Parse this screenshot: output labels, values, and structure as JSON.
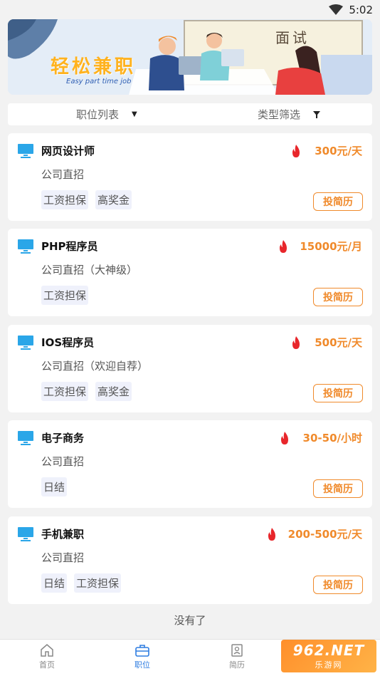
{
  "status": {
    "time": "5:02"
  },
  "banner": {
    "title": "轻松兼职",
    "subtitle": "Easy part time job",
    "board_text": "面试"
  },
  "filter": {
    "list_label": "职位列表",
    "type_label": "类型筛选"
  },
  "jobs": [
    {
      "title": "网页设计师",
      "salary": "300元/天",
      "company": "公司直招",
      "tags": [
        "工资担保",
        "高奖金"
      ],
      "apply": "投简历"
    },
    {
      "title": "PHP程序员",
      "salary": "15000元/月",
      "company": "公司直招（大神级）",
      "tags": [
        "工资担保"
      ],
      "apply": "投简历"
    },
    {
      "title": "IOS程序员",
      "salary": "500元/天",
      "company": "公司直招（欢迎自荐）",
      "tags": [
        "工资担保",
        "高奖金"
      ],
      "apply": "投简历"
    },
    {
      "title": "电子商务",
      "salary": "30-50/小时",
      "company": "公司直招",
      "tags": [
        "日结"
      ],
      "apply": "投简历"
    },
    {
      "title": "手机兼职",
      "salary": "200-500元/天",
      "company": "公司直招",
      "tags": [
        "日结",
        "工资担保"
      ],
      "apply": "投简历"
    }
  ],
  "footer": {
    "no_more": "没有了"
  },
  "tabs": [
    {
      "label": "首页",
      "icon": "home-icon"
    },
    {
      "label": "职位",
      "icon": "briefcase-icon"
    },
    {
      "label": "简历",
      "icon": "resume-icon"
    }
  ],
  "watermark": {
    "top": "962.NET",
    "bottom": "乐游网"
  },
  "colors": {
    "accent": "#f08a2b",
    "active_tab": "#2f7de1",
    "monitor_icon": "#2aa6e8",
    "fire": "#e8262b"
  }
}
